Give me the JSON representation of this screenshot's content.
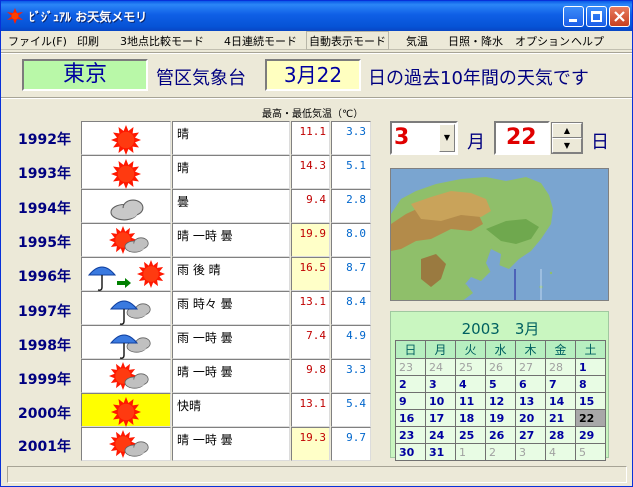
{
  "window": {
    "title": "ﾋﾞｼﾞｭｱﾙ お天気メモリ"
  },
  "menu": [
    "ファイル(F)",
    "印刷",
    "3地点比較モード",
    "4日連続モード",
    "自動表示モード",
    "気温",
    "日照・降水",
    "オプション",
    "ヘルプ"
  ],
  "header": {
    "city": "東京",
    "label1": "管区気象台",
    "date": "3月22",
    "label2": "日の過去10年間の天気です"
  },
  "table_header": "最高・最低気温（℃）",
  "rows": [
    {
      "year": "1992年",
      "weather": "晴",
      "high": "11.1",
      "low": "3.3",
      "icon": "sun-icon"
    },
    {
      "year": "1993年",
      "weather": "晴",
      "high": "14.3",
      "low": "5.1",
      "icon": "sun-icon"
    },
    {
      "year": "1994年",
      "weather": "曇",
      "high": "9.4",
      "low": "2.8",
      "icon": "cloud-icon"
    },
    {
      "year": "1995年",
      "weather": "晴 一時 曇",
      "high": "19.9",
      "low": "8.0",
      "icon": "sun-cloud-icon"
    },
    {
      "year": "1996年",
      "weather": "雨 後 晴",
      "high": "16.5",
      "low": "8.7",
      "icon": "rain-then-sun-icon"
    },
    {
      "year": "1997年",
      "weather": "雨 時々 曇",
      "high": "13.1",
      "low": "8.4",
      "icon": "rain-cloud-icon"
    },
    {
      "year": "1998年",
      "weather": "雨 一時 曇",
      "high": "7.4",
      "low": "4.9",
      "icon": "rain-cloud-icon"
    },
    {
      "year": "1999年",
      "weather": "晴 一時 曇",
      "high": "9.8",
      "low": "3.3",
      "icon": "sun-cloud-icon"
    },
    {
      "year": "2000年",
      "weather": "快晴",
      "high": "13.1",
      "low": "5.4",
      "icon": "clear-sun-icon"
    },
    {
      "year": "2001年",
      "weather": "晴 一時 曇",
      "high": "19.3",
      "low": "9.7",
      "icon": "sun-cloud-icon"
    }
  ],
  "selector": {
    "month": "3",
    "month_unit": "月",
    "day": "22",
    "day_unit": "日"
  },
  "calendar": {
    "title": "2003　3月",
    "weekdays": [
      "日",
      "月",
      "火",
      "水",
      "木",
      "金",
      "土"
    ],
    "weeks": [
      [
        "23",
        "24",
        "25",
        "26",
        "27",
        "28",
        "1"
      ],
      [
        "2",
        "3",
        "4",
        "5",
        "6",
        "7",
        "8"
      ],
      [
        "9",
        "10",
        "11",
        "12",
        "13",
        "14",
        "15"
      ],
      [
        "16",
        "17",
        "18",
        "19",
        "20",
        "21",
        "22"
      ],
      [
        "23",
        "24",
        "25",
        "26",
        "27",
        "28",
        "29"
      ],
      [
        "30",
        "31",
        "1",
        "2",
        "3",
        "4",
        "5"
      ]
    ],
    "out_of_month": [
      [
        0,
        0
      ],
      [
        0,
        1
      ],
      [
        0,
        2
      ],
      [
        0,
        3
      ],
      [
        0,
        4
      ],
      [
        0,
        5
      ],
      [
        5,
        2
      ],
      [
        5,
        3
      ],
      [
        5,
        4
      ],
      [
        5,
        5
      ],
      [
        5,
        6
      ]
    ],
    "selected": [
      3,
      6
    ]
  },
  "colors": {
    "title_bar": "#0a5ae8",
    "city_bg": "#b9f8a8",
    "date_bg": "#ffffc0",
    "high_temp": "#c00000",
    "low_temp": "#0066cc",
    "calendar_bg": "#c9f6c0"
  }
}
